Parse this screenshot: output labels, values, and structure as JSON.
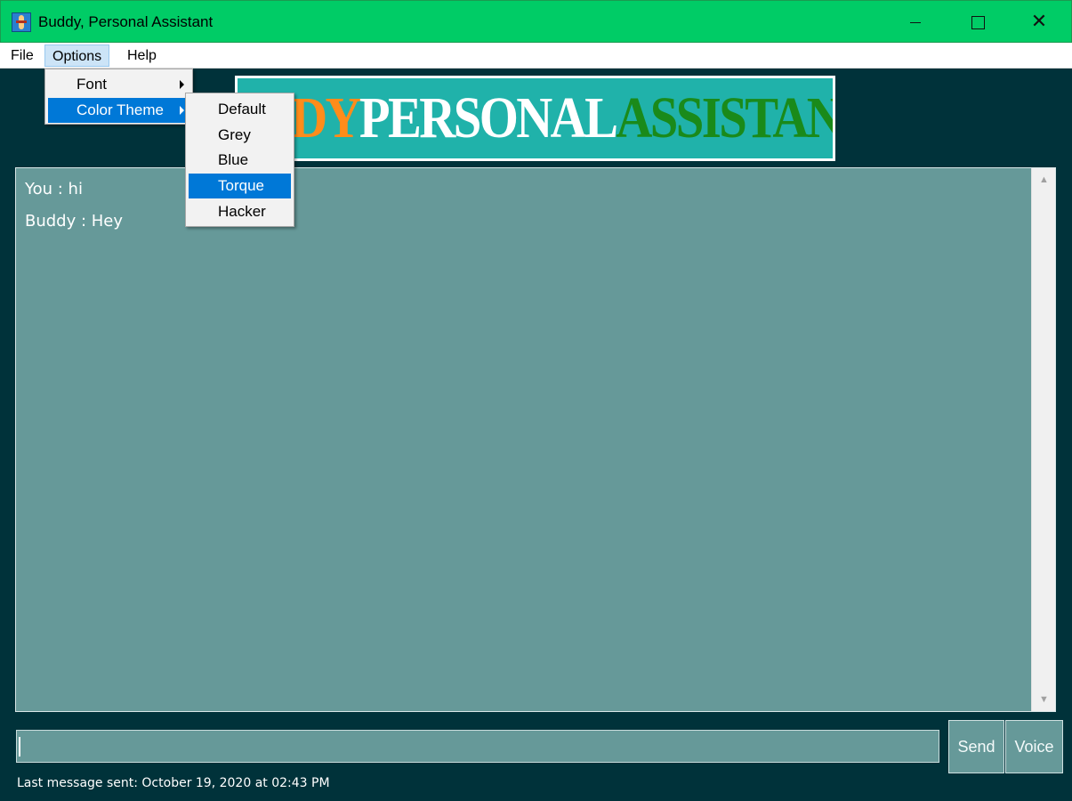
{
  "window": {
    "title": "Buddy, Personal Assistant",
    "minimize_icon": "minimize-icon",
    "maximize_icon": "maximize-icon",
    "close_icon": "close-icon",
    "close_glyph": "✕"
  },
  "menubar": {
    "file": "File",
    "options": "Options",
    "help": "Help"
  },
  "options_menu": {
    "font": "Font",
    "color_theme": "Color Theme",
    "selected": "Color Theme"
  },
  "color_theme_menu": {
    "items": [
      "Default",
      "Grey",
      "Blue",
      "Torque",
      "Hacker"
    ],
    "selected": "Torque"
  },
  "logo": {
    "part1": "BUDDY",
    "part2": "PERSONAL",
    "part3": "ASSISTANT"
  },
  "chat": {
    "messages": [
      "You : hi",
      "Buddy : Hey"
    ]
  },
  "input": {
    "value": ""
  },
  "buttons": {
    "send": "Send",
    "voice": "Voice"
  },
  "status": {
    "text": "Last message sent: October 19, 2020 at 02:43 PM"
  },
  "colors": {
    "titlebar": "#00cc66",
    "background": "#00323a",
    "chat_background": "#669999",
    "logo_background": "#20b2aa",
    "logo_orange": "#ff8c1a",
    "logo_green": "#1a8a1a",
    "menu_highlight": "#0078d7"
  }
}
